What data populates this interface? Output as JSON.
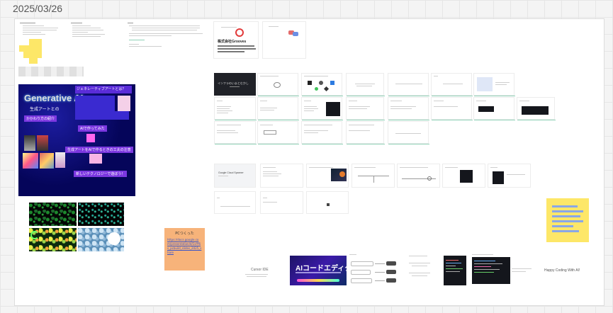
{
  "canvas": {
    "date_label": "2025/03/26"
  },
  "poster": {
    "title": "Generative AI",
    "subtitle": "生成アートとの",
    "chip_relationship": "かかわり方の紹介",
    "box_jukebox": "ジェネレーティブアートとは？",
    "chip_tried": "AIで作ってみた",
    "chip_notice": "生成アートをAIで作るときの工夫の注意",
    "chip_new_tech": "新しいテクノロジーで遊ぼう！"
  },
  "company": {
    "name": "株式会社Grooves"
  },
  "pc_note": {
    "title": "PCつくった",
    "url": "https://docs.google.com/presentation/d/1xYf6s_pcbuild_slides_2025_share"
  },
  "ai_banner": {
    "title": "AIコードエディタ"
  },
  "misc_text": {
    "cursor_label": "Cursor IDE",
    "happy_vibe_coding": "Happy Coding With AI!",
    "intro_slide": "インフラのいまとむかし",
    "google_doc_label": "Google Cloud Spanner"
  },
  "colors": {
    "poster_bg": "#05055a",
    "note_yellow": "#fde768",
    "note_orange": "#f7b37a",
    "accent_purple": "#7c38e0",
    "link_blue": "#3a55c8"
  }
}
